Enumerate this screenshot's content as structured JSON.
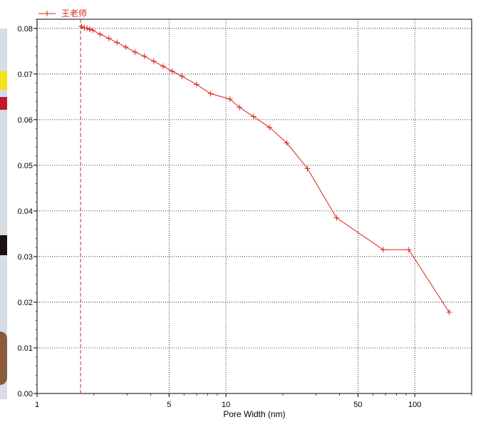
{
  "chart_data": {
    "type": "line",
    "title": "",
    "xlabel": "Pore Width (nm)",
    "ylabel": "",
    "x_scale": "log",
    "xlim": [
      1,
      200
    ],
    "ylim": [
      0,
      0.082
    ],
    "x_ticks": [
      {
        "value": 1,
        "label": "1"
      },
      {
        "value": 5,
        "label": "5"
      },
      {
        "value": 10,
        "label": "10"
      },
      {
        "value": 50,
        "label": "50"
      },
      {
        "value": 100,
        "label": "100"
      }
    ],
    "y_ticks": [
      {
        "value": 0.0,
        "label": "0.00"
      },
      {
        "value": 0.01,
        "label": "0.01"
      },
      {
        "value": 0.02,
        "label": "0.02"
      },
      {
        "value": 0.03,
        "label": "0.03"
      },
      {
        "value": 0.04,
        "label": "0.04"
      },
      {
        "value": 0.05,
        "label": "0.05"
      },
      {
        "value": 0.06,
        "label": "0.06"
      },
      {
        "value": 0.07,
        "label": "0.07"
      },
      {
        "value": 0.08,
        "label": "0.08"
      }
    ],
    "grid": true,
    "legend_position": "top-left",
    "reference_line_x": 1.7,
    "series": [
      {
        "name": "王老师",
        "color": "#d9241c",
        "marker": "plus",
        "x": [
          1.72,
          1.78,
          1.84,
          1.9,
          1.97,
          2.16,
          2.4,
          2.65,
          2.95,
          3.3,
          3.7,
          4.15,
          4.65,
          5.2,
          5.85,
          7.0,
          8.3,
          10.5,
          11.8,
          14.0,
          17.0,
          21.0,
          27.0,
          38.5,
          68.0,
          93.0,
          152.0
        ],
        "y": [
          0.0804,
          0.0801,
          0.08,
          0.0798,
          0.0796,
          0.0787,
          0.0778,
          0.0769,
          0.0759,
          0.0748,
          0.0739,
          0.0728,
          0.0717,
          0.0706,
          0.0695,
          0.0677,
          0.0657,
          0.0645,
          0.0627,
          0.0607,
          0.0583,
          0.0549,
          0.0493,
          0.0385,
          0.0315,
          0.0315,
          0.0178
        ]
      }
    ]
  },
  "colors": {
    "series": "#d9241c",
    "grid": "#000000",
    "reference_line": "#c23030"
  }
}
